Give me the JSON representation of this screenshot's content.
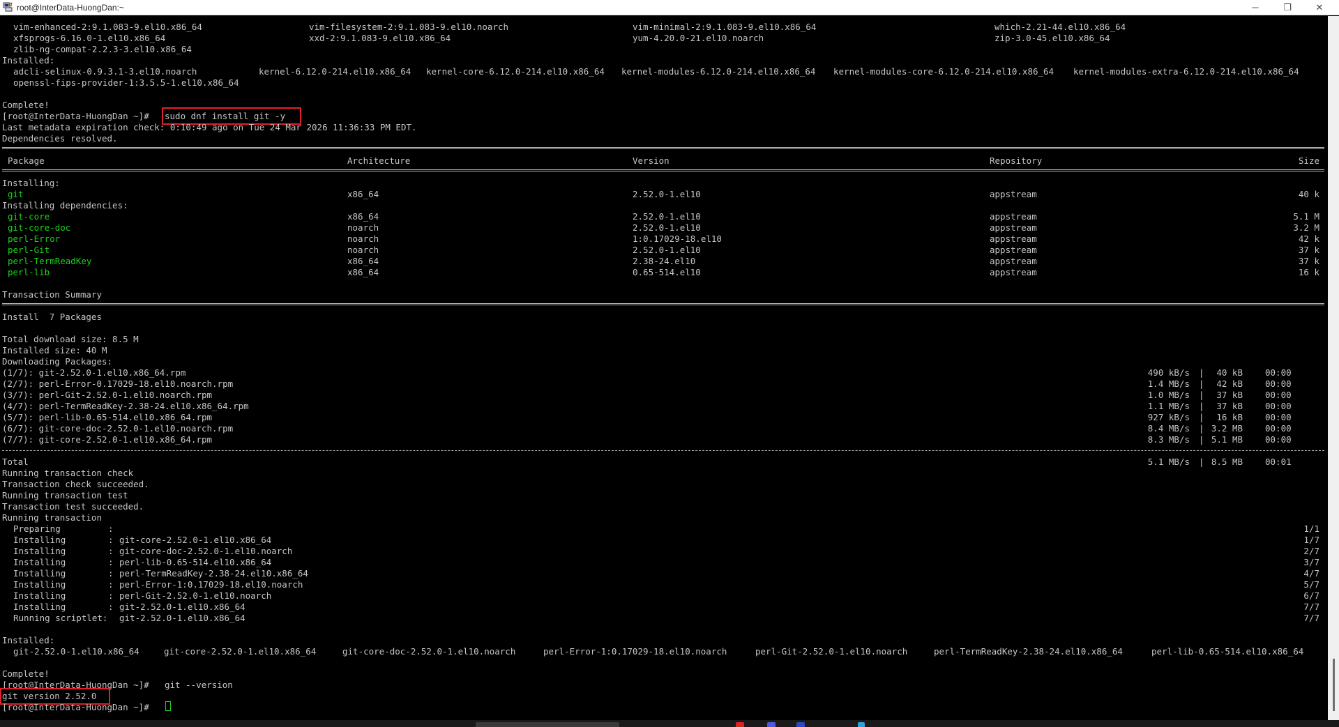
{
  "window": {
    "title": "root@InterData-HuongDan:~",
    "icon": "putty-terminal-icon",
    "controls": {
      "minimize": "─",
      "maximize": "❐",
      "close": "✕"
    }
  },
  "colors": {
    "background": "#000000",
    "text": "#c6c6c6",
    "package_green": "#19d419",
    "highlight_box": "#e0202a"
  },
  "terminal": {
    "top": {
      "r0": [
        "vim-enhanced-2:9.1.083-9.el10.x86_64",
        "vim-filesystem-2:9.1.083-9.el10.noarch",
        "vim-minimal-2:9.1.083-9.el10.x86_64",
        "which-2.21-44.el10.x86_64"
      ],
      "r1": [
        "xfsprogs-6.16.0-1.el10.x86_64",
        "xxd-2:9.1.083-9.el10.x86_64",
        "yum-4.20.0-21.el10.noarch",
        "zip-3.0-45.el10.x86_64"
      ],
      "r2": "zlib-ng-compat-2.2.3-3.el10.x86_64",
      "installed_label": "Installed:",
      "r4": [
        "adcli-selinux-0.9.3.1-3.el10.noarch",
        "kernel-6.12.0-214.el10.x86_64",
        "kernel-core-6.12.0-214.el10.x86_64",
        "kernel-modules-6.12.0-214.el10.x86_64",
        "kernel-modules-core-6.12.0-214.el10.x86_64",
        "kernel-modules-extra-6.12.0-214.el10.x86_64"
      ],
      "r5": "openssl-fips-provider-1:3.5.5-1.el10.x86_64",
      "complete": "Complete!"
    },
    "prompt": "[root@InterData-HuongDan ~]#",
    "cmd_install": "sudo dnf install git -y",
    "metadata": "Last metadata expiration check: 0:10:49 ago on Tue 24 Mar 2026 11:36:33 PM EDT.",
    "deps_resolved": "Dependencies resolved.",
    "headers": {
      "package": "Package",
      "arch": "Architecture",
      "version": "Version",
      "repo": "Repository",
      "size": "Size"
    },
    "installing_label": "Installing:",
    "installing_deps_label": "Installing dependencies:",
    "packages": [
      [
        "git",
        "x86_64",
        "2.52.0-1.el10",
        "appstream",
        "40 k"
      ],
      [
        "git-core",
        "x86_64",
        "2.52.0-1.el10",
        "appstream",
        "5.1 M"
      ],
      [
        "git-core-doc",
        "noarch",
        "2.52.0-1.el10",
        "appstream",
        "3.2 M"
      ],
      [
        "perl-Error",
        "noarch",
        "1:0.17029-18.el10",
        "appstream",
        "42 k"
      ],
      [
        "perl-Git",
        "noarch",
        "2.52.0-1.el10",
        "appstream",
        "37 k"
      ],
      [
        "perl-TermReadKey",
        "x86_64",
        "2.38-24.el10",
        "appstream",
        "37 k"
      ],
      [
        "perl-lib",
        "x86_64",
        "0.65-514.el10",
        "appstream",
        "16 k"
      ]
    ],
    "txn_summary": "Transaction Summary",
    "install_count": "Install  7 Packages",
    "total_download": "Total download size: 8.5 M",
    "installed_size": "Installed size: 40 M",
    "downloading": "Downloading Packages:",
    "downloads": [
      [
        "(1/7): git-2.52.0-1.el10.x86_64.rpm",
        "490 kB/s",
        "40 kB",
        "00:00"
      ],
      [
        "(2/7): perl-Error-0.17029-18.el10.noarch.rpm",
        "1.4 MB/s",
        "42 kB",
        "00:00"
      ],
      [
        "(3/7): perl-Git-2.52.0-1.el10.noarch.rpm",
        "1.0 MB/s",
        "37 kB",
        "00:00"
      ],
      [
        "(4/7): perl-TermReadKey-2.38-24.el10.x86_64.rpm",
        "1.1 MB/s",
        "37 kB",
        "00:00"
      ],
      [
        "(5/7): perl-lib-0.65-514.el10.x86_64.rpm",
        "927 kB/s",
        "16 kB",
        "00:00"
      ],
      [
        "(6/7): git-core-doc-2.52.0-1.el10.noarch.rpm",
        "8.4 MB/s",
        "3.2 MB",
        "00:00"
      ],
      [
        "(7/7): git-core-2.52.0-1.el10.x86_64.rpm",
        "8.3 MB/s",
        "5.1 MB",
        "00:00"
      ]
    ],
    "total": [
      "Total",
      "5.1 MB/s",
      "8.5 MB",
      "00:01"
    ],
    "pipe": "|",
    "txn_lines": [
      "Running transaction check",
      "Transaction check succeeded.",
      "Running transaction test",
      "Transaction test succeeded.",
      "Running transaction"
    ],
    "steps": [
      [
        "Preparing",
        ":",
        "",
        "1/1"
      ],
      [
        "Installing",
        ":",
        "git-core-2.52.0-1.el10.x86_64",
        "1/7"
      ],
      [
        "Installing",
        ":",
        "git-core-doc-2.52.0-1.el10.noarch",
        "2/7"
      ],
      [
        "Installing",
        ":",
        "perl-lib-0.65-514.el10.x86_64",
        "3/7"
      ],
      [
        "Installing",
        ":",
        "perl-TermReadKey-2.38-24.el10.x86_64",
        "4/7"
      ],
      [
        "Installing",
        ":",
        "perl-Error-1:0.17029-18.el10.noarch",
        "5/7"
      ],
      [
        "Installing",
        ":",
        "perl-Git-2.52.0-1.el10.noarch",
        "6/7"
      ],
      [
        "Installing",
        ":",
        "git-2.52.0-1.el10.x86_64",
        "7/7"
      ],
      [
        "Running scriptlet:",
        "",
        "git-2.52.0-1.el10.x86_64",
        "7/7"
      ]
    ],
    "installed_label2": "Installed:",
    "installed_pkgs": [
      "git-2.52.0-1.el10.x86_64",
      "git-core-2.52.0-1.el10.x86_64",
      "git-core-doc-2.52.0-1.el10.noarch",
      "perl-Error-1:0.17029-18.el10.noarch",
      "perl-Git-2.52.0-1.el10.noarch",
      "perl-TermReadKey-2.38-24.el10.x86_64",
      "perl-lib-0.65-514.el10.x86_64"
    ],
    "complete2": "Complete!",
    "cmd_version": "git --version",
    "version_output": "git version 2.52.0"
  }
}
